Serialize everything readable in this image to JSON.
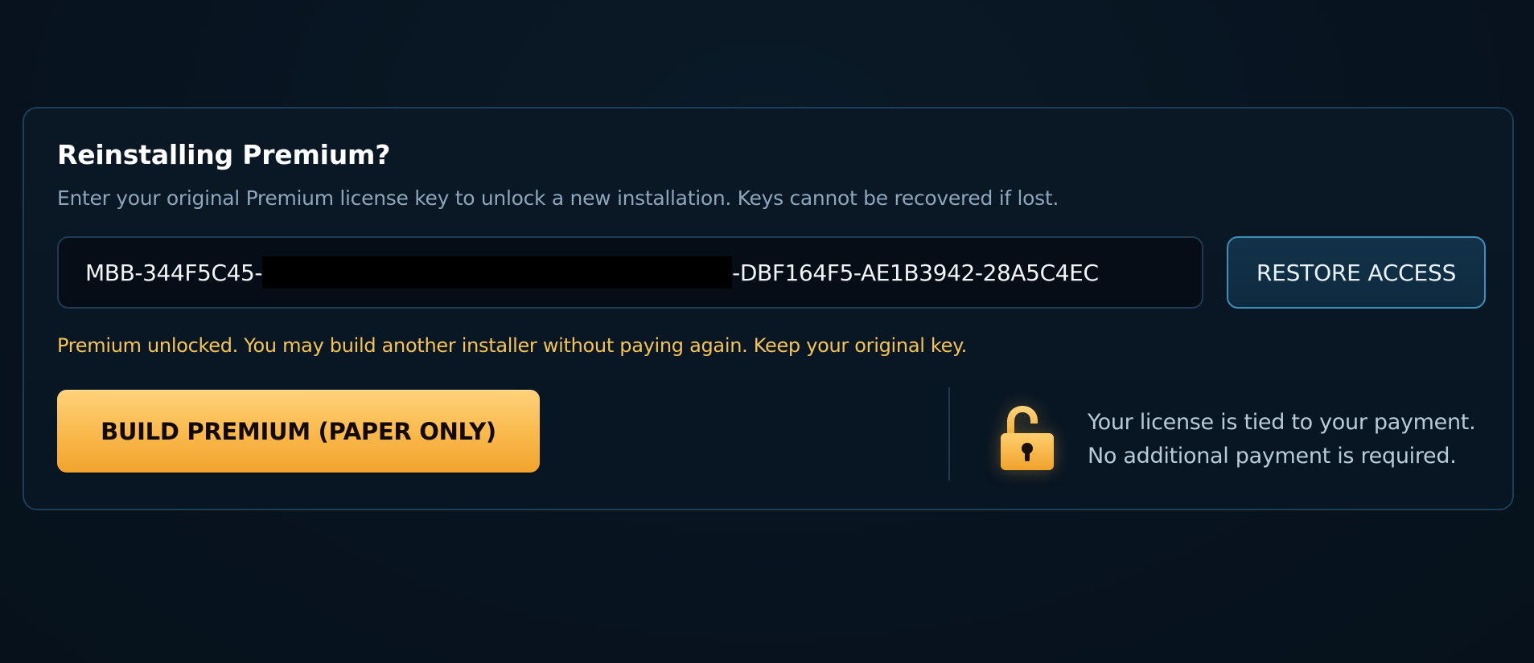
{
  "panel": {
    "title": "Reinstalling Premium?",
    "subtitle": "Enter your original Premium license key to unlock a new installation. Keys cannot be recovered if lost.",
    "license_key": {
      "prefix": "MBB-344F5C45-",
      "suffix": "-DBF164F5-AE1B3942-28A5C4EC",
      "redacted": true
    },
    "restore_button_label": "RESTORE ACCESS",
    "status_message": "Premium unlocked. You may build another installer without paying again. Keep your original key.",
    "build_button_label": "BUILD PREMIUM (PAPER ONLY)",
    "info": {
      "icon": "unlocked-padlock-icon",
      "line1": "Your license is tied to your payment.",
      "line2": "No additional payment is required."
    }
  },
  "colors": {
    "background": "#07131f",
    "accent_gold": "#f9b84a",
    "status_text": "#f6c453",
    "border": "#1d3e57",
    "restore_border": "#3f8fb8"
  }
}
